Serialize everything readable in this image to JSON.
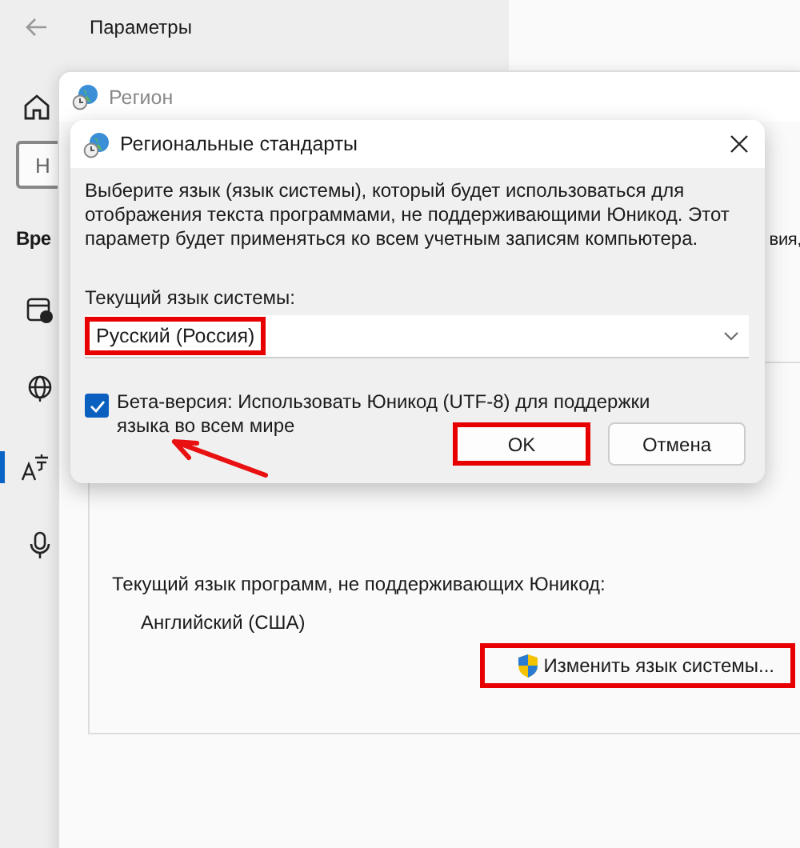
{
  "settings": {
    "title": "Параметры",
    "search_placeholder": "Н",
    "section_heading": "Вре",
    "nav_items": [
      {
        "kind": "calendar",
        "selected": false
      },
      {
        "kind": "globe",
        "selected": false
      },
      {
        "kind": "language",
        "selected": true
      },
      {
        "kind": "mic",
        "selected": false
      }
    ]
  },
  "region_dialog": {
    "title": "Регион",
    "tab_fragment": "вия,",
    "unicode_label": "Текущий язык программ, не поддерживающих Юникод:",
    "unicode_value": "Английский (США)",
    "change_button": {
      "label": "Изменить язык системы...",
      "highlighted": true
    }
  },
  "locale_dialog": {
    "title": "Региональные стандарты",
    "description": "Выберите язык (язык системы), который будет использоваться для отображения текста программами, не поддерживающими Юникод. Этот параметр будет применяться ко всем учетным записям компьютера.",
    "system_locale_label": "Текущий язык системы:",
    "system_locale": {
      "value": "Русский (Россия)",
      "highlighted": true
    },
    "utf8_checkbox": {
      "label": "Бета-версия: Использовать Юникод (UTF-8) для поддержки языка во всем мире",
      "checked": true,
      "pointer_arrow": true
    },
    "buttons": [
      {
        "label": "OK",
        "kind": "primary",
        "highlighted": true
      },
      {
        "label": "Отмена",
        "kind": "secondary",
        "highlighted": false
      }
    ]
  }
}
